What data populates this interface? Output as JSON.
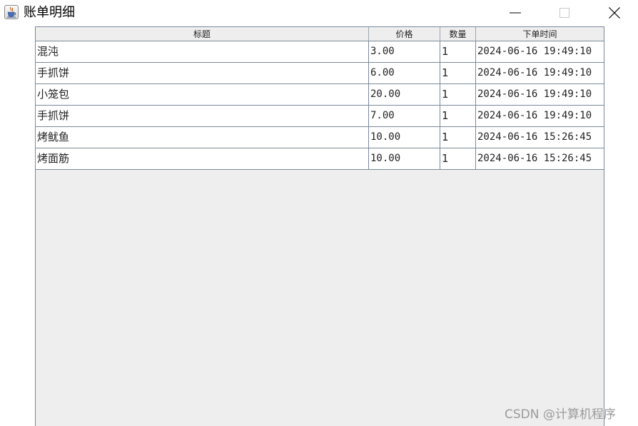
{
  "window": {
    "title": "账单明细"
  },
  "table": {
    "columns": [
      "标题",
      "价格",
      "数量",
      "下单时间"
    ],
    "rows": [
      {
        "title": "混沌",
        "price": "3.00",
        "qty": "1",
        "time": "2024-06-16 19:49:10"
      },
      {
        "title": "手抓饼",
        "price": "6.00",
        "qty": "1",
        "time": "2024-06-16 19:49:10"
      },
      {
        "title": "小笼包",
        "price": "20.00",
        "qty": "1",
        "time": "2024-06-16 19:49:10"
      },
      {
        "title": "手抓饼",
        "price": "7.00",
        "qty": "1",
        "time": "2024-06-16 19:49:10"
      },
      {
        "title": "烤鱿鱼",
        "price": "10.00",
        "qty": "1",
        "time": "2024-06-16 15:26:45"
      },
      {
        "title": "烤面筋",
        "price": "10.00",
        "qty": "1",
        "time": "2024-06-16 15:26:45"
      }
    ]
  },
  "watermark": "CSDN @计算机程序",
  "colors": {
    "grid": "#7a8a99",
    "panel_bg": "#eeeeee",
    "edge_accent": "#1b3fd6"
  },
  "icons": {
    "app": "java-coffee-cup-icon",
    "minimize": "minimize-icon",
    "maximize": "maximize-icon",
    "close": "close-icon"
  }
}
